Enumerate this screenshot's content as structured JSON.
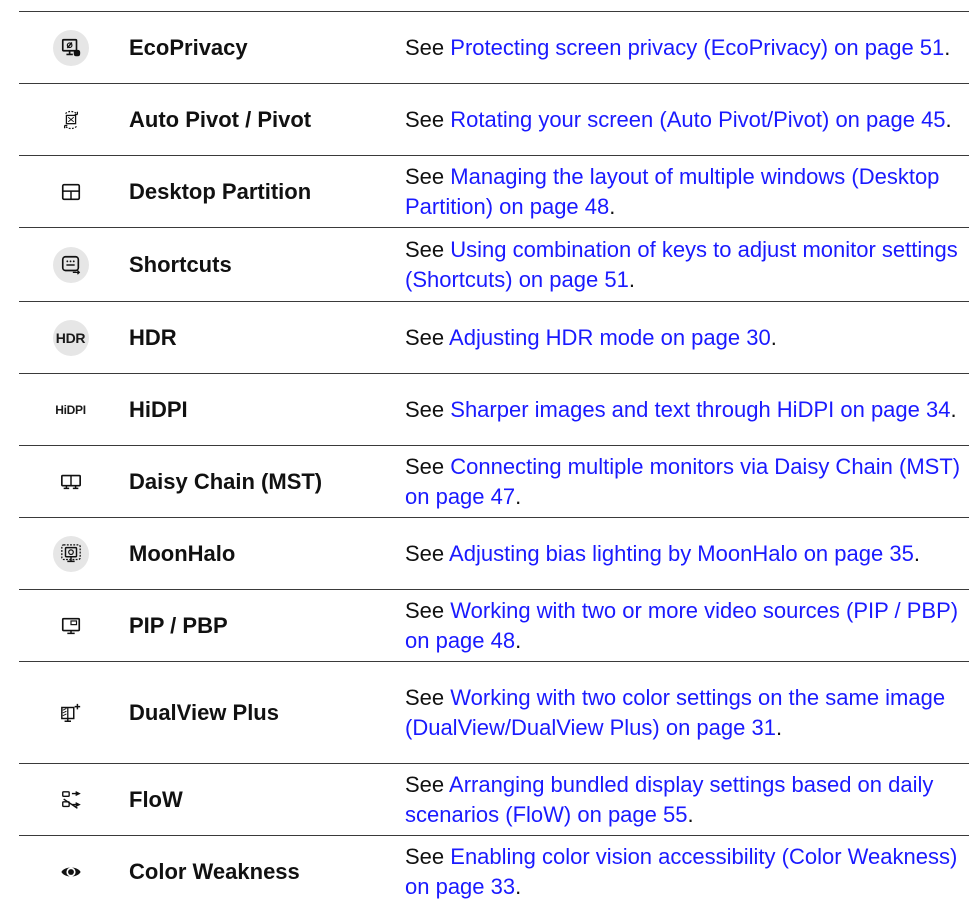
{
  "rows": [
    {
      "icon": "eco-privacy-icon",
      "name": "EcoPrivacy",
      "see": "See ",
      "link": "Protecting screen privacy (EcoPrivacy) on page 51",
      "end": "."
    },
    {
      "icon": "auto-pivot-icon",
      "name": "Auto Pivot / Pivot",
      "see": "See ",
      "link": "Rotating your screen (Auto Pivot/Pivot) on page 45",
      "end": "."
    },
    {
      "icon": "desktop-partition-icon",
      "name": "Desktop Partition",
      "see": "See ",
      "link": "Managing the layout of multiple windows (Desktop Partition) on page 48",
      "end": "."
    },
    {
      "icon": "shortcuts-icon",
      "name": "Shortcuts",
      "see": "See ",
      "link": "Using combination of keys to adjust monitor settings (Shortcuts) on page 51",
      "end": "."
    },
    {
      "icon": "hdr-icon",
      "icon_text": "HDR",
      "name": "HDR",
      "see": "See ",
      "link": "Adjusting HDR mode on page 30",
      "end": "."
    },
    {
      "icon": "hidpi-icon",
      "icon_text": "HiDPI",
      "name": "HiDPI",
      "see": "See ",
      "link": "Sharper images and text through HiDPI on page 34",
      "end": "."
    },
    {
      "icon": "daisy-chain-icon",
      "name": "Daisy Chain (MST)",
      "see": "See ",
      "link": "Connecting multiple monitors via Daisy Chain (MST) on page 47",
      "end": "."
    },
    {
      "icon": "moonhalo-icon",
      "name": "MoonHalo",
      "see": "See ",
      "link": "Adjusting bias lighting by MoonHalo on page 35",
      "end": "."
    },
    {
      "icon": "pip-pbp-icon",
      "name": "PIP / PBP",
      "see": "See ",
      "link": "Working with two or more video sources (PIP / PBP) on page 48",
      "end": "."
    },
    {
      "icon": "dualview-plus-icon",
      "name": "DualView Plus",
      "see": "See ",
      "link": "Working with two color settings on the same image (DualView/DualView Plus) on page 31",
      "end": "."
    },
    {
      "icon": "flow-icon",
      "name": "FloW",
      "see": "See ",
      "link": "Arranging bundled display settings based on daily scenarios (FloW) on page 55",
      "end": "."
    },
    {
      "icon": "color-weakness-icon",
      "name": "Color Weakness",
      "see": "See ",
      "link": "Enabling color vision accessibility (Color Weakness) on page 33",
      "end": "."
    }
  ]
}
